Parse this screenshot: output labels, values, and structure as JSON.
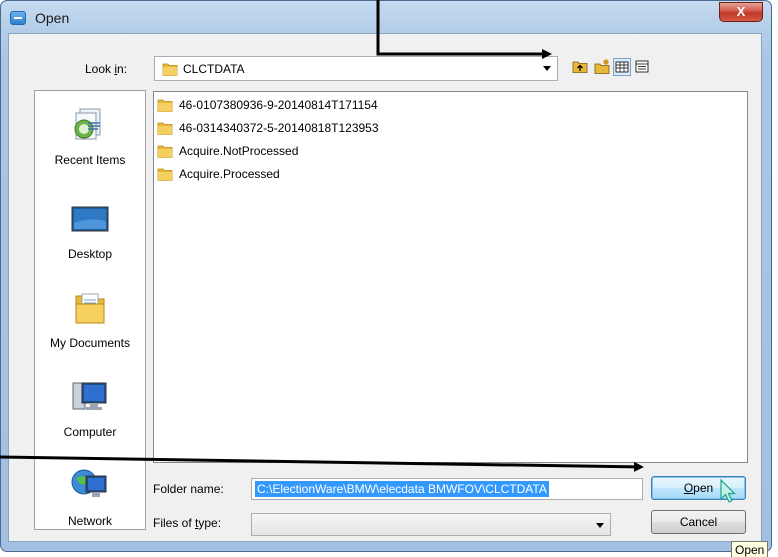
{
  "window": {
    "title": "Open",
    "close_glyph": "X"
  },
  "lookin": {
    "label_before": "Look ",
    "label_accel": "i",
    "label_after": "n:",
    "value": "CLCTDATA"
  },
  "toolbar": {
    "icons": [
      "up-folder-icon",
      "new-folder-icon",
      "view-menu-icon",
      "details-view-icon"
    ]
  },
  "places": [
    {
      "label": "Recent Items",
      "icon": "recent-items-icon"
    },
    {
      "label": "Desktop",
      "icon": "desktop-icon"
    },
    {
      "label": "My Documents",
      "icon": "my-documents-icon"
    },
    {
      "label": "Computer",
      "icon": "computer-icon"
    },
    {
      "label": "Network",
      "icon": "network-icon"
    }
  ],
  "files": [
    {
      "name": "46-0107380936-9-20140814T171154"
    },
    {
      "name": "46-0314340372-5-20140818T123953"
    },
    {
      "name": "Acquire.NotProcessed"
    },
    {
      "name": "Acquire.Processed"
    }
  ],
  "folder_name": {
    "label": "Folder name:",
    "value": "C:\\ElectionWare\\BMW\\elecdata BMWFOV\\CLCTDATA"
  },
  "files_of_type": {
    "label_before": "Files of ",
    "label_accel": "t",
    "label_after": "ype:",
    "value": ""
  },
  "buttons": {
    "open_accel": "O",
    "open_rest": "pen",
    "cancel": "Cancel"
  },
  "tooltip": "Open",
  "colors": {
    "folder": "#e8b838",
    "selection": "#3399ff",
    "annotation_arrow": "#000000"
  }
}
